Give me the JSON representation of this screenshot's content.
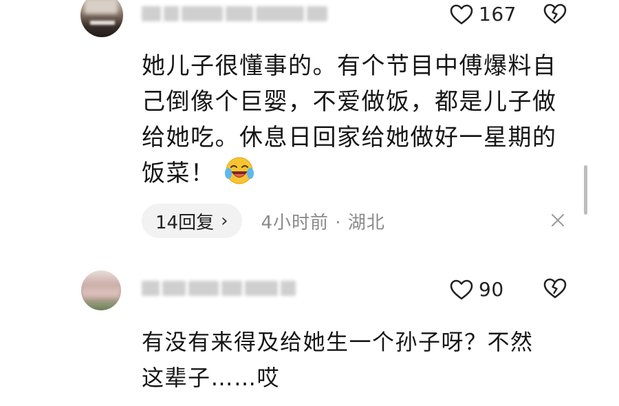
{
  "comments": [
    {
      "likes": "167",
      "text_lines": [
        "她儿子很懂事的。有个节目中傅爆料自",
        "己倒像个巨婴，不爱做饭，都是儿子做",
        "给她吃。休息日回家给她做好一星期的",
        "饭菜！"
      ],
      "emoji": "laughing-crying-emoji",
      "replies_label": "14回复",
      "meta": "4小时前 · 湖北"
    },
    {
      "likes": "90",
      "text_lines": [
        "有没有来得及给她生一个孙子呀？不然",
        "这辈子……哎"
      ]
    }
  ],
  "icons": {
    "like": "heart-outline-icon",
    "dislike": "broken-heart-icon",
    "close": "close-icon",
    "chevron": "chevron-right-icon"
  },
  "colors": {
    "text": "#161616",
    "meta": "#8a8a8a",
    "reply_pill": "#f2f2f2"
  }
}
